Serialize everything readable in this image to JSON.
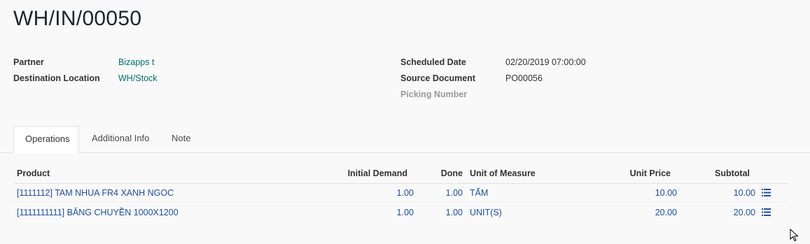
{
  "record": {
    "title": "WH/IN/00050"
  },
  "fields_left": [
    {
      "label": "Partner",
      "value": "Bizapps t"
    },
    {
      "label": "Destination Location",
      "value": "WH/Stock"
    }
  ],
  "fields_right": [
    {
      "label": "Scheduled Date",
      "value": "02/20/2019 07:00:00"
    },
    {
      "label": "Source Document",
      "value": "PO00056"
    },
    {
      "label": "Picking Number",
      "value": ""
    }
  ],
  "tabs": [
    {
      "label": "Operations",
      "active": true
    },
    {
      "label": "Additional Info",
      "active": false
    },
    {
      "label": "Note",
      "active": false
    }
  ],
  "table": {
    "columns": {
      "product": "Product",
      "initial_demand": "Initial Demand",
      "done": "Done",
      "uom": "Unit of Measure",
      "unit_price": "Unit Price",
      "subtotal": "Subtotal"
    },
    "rows": [
      {
        "product": "[1111112] TAM NHUA FR4 XANH NGOC",
        "initial_demand": "1.00",
        "done": "1.00",
        "uom": "TẤM",
        "unit_price": "10.00",
        "subtotal": "10.00"
      },
      {
        "product": "[1111111111] BĂNG CHUYỀN 1000X1200",
        "initial_demand": "1.00",
        "done": "1.00",
        "uom": "UNIT(S)",
        "unit_price": "20.00",
        "subtotal": "20.00"
      }
    ]
  },
  "icons": {
    "row_detail": "list-icon",
    "cursor": "mouse-pointer-icon"
  },
  "colors": {
    "link": "#00736c",
    "table_text": "#1f4fa3"
  }
}
